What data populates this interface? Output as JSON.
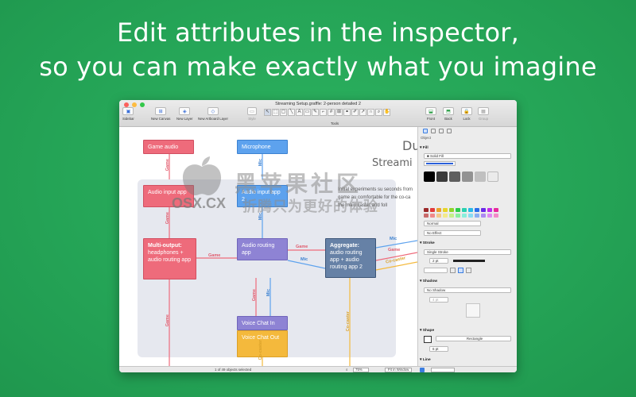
{
  "headline": {
    "line1": "Edit attributes in the inspector,",
    "line2": "so you can make exactly what you imagine"
  },
  "window": {
    "title": "Streaming Setup.graffle: 2-person detailed 2",
    "toolbar": {
      "sidebar": "Sidebar",
      "new_canvas": "New Canvas",
      "new_layer": "New Layer",
      "new_artboard_layer": "New Artboard Layer",
      "style": "Style",
      "tools": "Tools",
      "front": "Front",
      "back": "Back",
      "lock": "Lock",
      "group": "Group"
    }
  },
  "canvas": {
    "title_fragment_1": "Du",
    "title_fragment_2": "Streami",
    "paragraph": "Initial experiments su seconds from game au comfortable for the co-ca the main caster and foll",
    "nodes": {
      "game_audio": "Game audio",
      "microphone": "Microphone",
      "audio_input_app": "Audio input app",
      "audio_input_app2": "Audio input app 2",
      "multi_output_title": "Multi-output:",
      "multi_output_body": "headphones + audio routing app",
      "audio_routing_app": "Audio routing app",
      "aggregate_title": "Aggregate:",
      "aggregate_body": "audio routing app + audio routing app 2",
      "voice_chat_in": "Voice Chat In",
      "voice_chat_out": "Voice Chat Out"
    },
    "edge_labels": {
      "game": "Game",
      "mic": "Mic",
      "co_caster": "Co-caster"
    }
  },
  "inspector": {
    "header": "Object",
    "fill": {
      "section": "Fill",
      "type": "Solid Fill",
      "blend": "Normal",
      "effect": "No Effect"
    },
    "stroke": {
      "section": "Stroke",
      "type": "Single Stroke",
      "width": "2 pt"
    },
    "shadow": {
      "section": "Shadow",
      "type": "No Shadow",
      "size": "4 pt"
    },
    "shape": {
      "section": "Shape",
      "type": "Rectangle",
      "corner": "6 pt"
    },
    "line": {
      "section": "Line"
    }
  },
  "statusbar": {
    "selection": "1 of 49 objects selected",
    "zoom": "75%",
    "fit": "Fit in Window"
  },
  "watermark": {
    "brand": "黑苹果社区",
    "domain": "OSX.CX",
    "slogan": "折腾只为更好的体验"
  },
  "colors": {
    "background": "#25a557",
    "red_node": "#ee6b7b",
    "blue_node": "#5da2ee",
    "purple_node": "#8e83d4",
    "slate_node": "#6681a6",
    "orange_node": "#f4b93c"
  },
  "icons": [
    "sidebar-icon",
    "canvas-icon",
    "layer-icon",
    "artboard-icon",
    "style-icon",
    "pointer-icon",
    "text-icon",
    "pen-icon",
    "zoom-icon",
    "hand-icon",
    "front-icon",
    "back-icon",
    "lock-icon",
    "group-icon"
  ]
}
